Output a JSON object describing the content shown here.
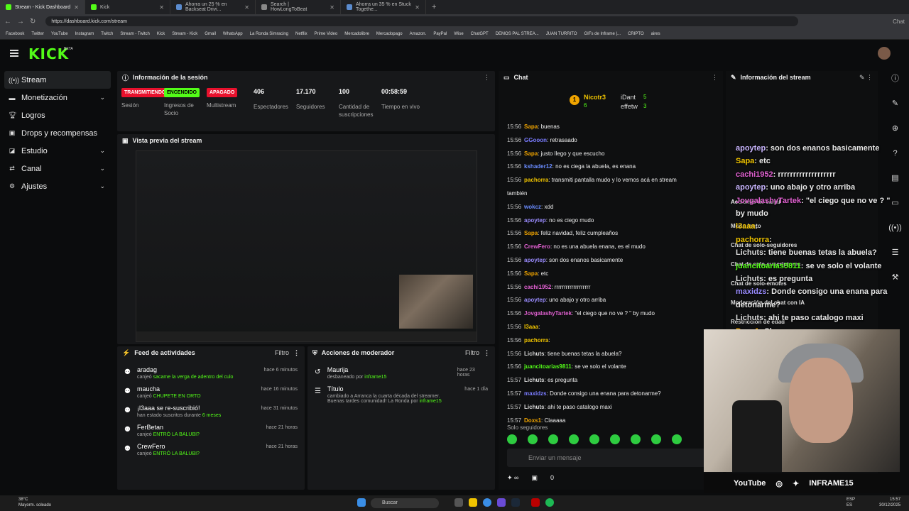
{
  "browser": {
    "tabs": [
      {
        "label": "Stream - Kick Dashboard"
      },
      {
        "label": "Kick"
      },
      {
        "label": "Ahorra un 25 % en Backseat Drivi..."
      },
      {
        "label": "Search | HowLongToBeat"
      },
      {
        "label": "Ahorra un 35 % en Stuck Togethe..."
      }
    ],
    "url": "https://dashboard.kick.com/stream",
    "bookmarks": [
      "Facebook",
      "Twitter",
      "YouTube",
      "Instagram",
      "Twitch",
      "Stream - Twitch",
      "Kick",
      "Stream - Kick",
      "Gmail",
      "WhatsApp",
      "La Ronda Simracing",
      "Netflix",
      "Prime Video",
      "Mercadolibre",
      "Mercadopago",
      "Amazon.",
      "PayPal",
      "Wise",
      "ChatGPT",
      "DEMOS PAL STREA...",
      "JUAN TURRITO",
      "GIFs de Inframe |...",
      "CRIPTO",
      "aires"
    ],
    "chat_btn": "Chat"
  },
  "header": {
    "logo": "KICK",
    "beta": "BETA"
  },
  "sidebar": {
    "items": [
      {
        "label": "Stream"
      },
      {
        "label": "Monetización"
      },
      {
        "label": "Logros"
      },
      {
        "label": "Drops y recompensas"
      },
      {
        "label": "Estudio"
      },
      {
        "label": "Canal"
      },
      {
        "label": "Ajustes"
      }
    ]
  },
  "session": {
    "title": "Información de la sesión",
    "stats": [
      {
        "value": "TRANSMITIENDO",
        "label": "Sesión",
        "kind": "red"
      },
      {
        "value": "ENCENDIDO",
        "label": "Ingresos de Socio",
        "kind": "green"
      },
      {
        "value": "APAGADO",
        "label": "Multistream",
        "kind": "red"
      },
      {
        "value": "406",
        "label": "Espectadores"
      },
      {
        "value": "17.170",
        "label": "Seguidores"
      },
      {
        "value": "100",
        "label": "Cantidad de suscripciones"
      },
      {
        "value": "00:58:59",
        "label": "Tiempo en vivo"
      }
    ]
  },
  "preview": {
    "title": "Vista previa del stream"
  },
  "feed": {
    "title": "Feed de actividades",
    "filter": "Filtro",
    "rows": [
      {
        "name": "aradag",
        "action": "canjeó",
        "detail": "sacame la verga de adentro del culo",
        "time": "hace 6 minutos"
      },
      {
        "name": "maucha",
        "action": "canjeó",
        "detail": "CHUPETE EN ORTO",
        "time": "hace 16 minutos"
      },
      {
        "name": "¡l3aaa se re-suscribió!",
        "action": "han estado suscritos durante",
        "detail": "6 meses",
        "time": "hace 31 minutos"
      },
      {
        "name": "FerBetan",
        "action": "canjeó",
        "detail": "ENTRÓ LA BALUBI?",
        "time": "hace 21 horas"
      },
      {
        "name": "CrewFero",
        "action": "canjeó",
        "detail": "ENTRÓ LA BALUBI?",
        "time": "hace 21 horas"
      }
    ]
  },
  "mod": {
    "title": "Acciones de moderador",
    "filter": "Filtro",
    "rows": [
      {
        "name": "Maurija",
        "detail": "desbaneado por",
        "by": "inframe15",
        "time": "hace 23 horas"
      },
      {
        "name": "Título",
        "detail": "cambiado a Arranca la cuarta década del streamer. Buenas tardes comunidad! La Ronda por",
        "by": "inframe15",
        "time": "hace 1 día"
      }
    ]
  },
  "chat": {
    "title": "Chat",
    "top": [
      {
        "name": "Nicotr3",
        "count": "6"
      },
      {
        "name": "iDant",
        "count": "5"
      },
      {
        "name": "effetw",
        "count": "3"
      }
    ],
    "messages": [
      {
        "time": "15:56",
        "user": "Sapa",
        "color": "#f0a400",
        "text": "buenas"
      },
      {
        "time": "15:56",
        "user": "GGooon",
        "color": "#7a7cff",
        "text": "retrasaado"
      },
      {
        "time": "15:56",
        "user": "Sapa",
        "color": "#f0a400",
        "text": "justo llego y que escucho"
      },
      {
        "time": "15:56",
        "user": "kshader12",
        "color": "#6a8cff",
        "text": "no es ciega la abuela, es enana"
      },
      {
        "time": "15:56",
        "user": "pachorra",
        "color": "#f0c400",
        "text": "transmiti pantalla mudo y lo vemos acá en stream"
      },
      {
        "time": "",
        "user": "",
        "color": "#eee",
        "text": "también"
      },
      {
        "time": "15:56",
        "user": "wokcz",
        "color": "#6a8cff",
        "text": "xdd"
      },
      {
        "time": "15:56",
        "user": "apoytep",
        "color": "#9a8cff",
        "text": "no es ciego mudo"
      },
      {
        "time": "15:56",
        "user": "Sapa",
        "color": "#f0a400",
        "text": "feliz navidad, feliz cumpleaños"
      },
      {
        "time": "15:56",
        "user": "CrewFero",
        "color": "#e060d0",
        "text": "no es una abuela enana, es el mudo"
      },
      {
        "time": "15:56",
        "user": "apoytep",
        "color": "#9a8cff",
        "text": "son dos enanos basicamente"
      },
      {
        "time": "15:56",
        "user": "Sapa",
        "color": "#f0a400",
        "text": "etc"
      },
      {
        "time": "15:56",
        "user": "cachi1952",
        "color": "#e060d0",
        "text": "rrrrrrrrrrrrrrrrrrr"
      },
      {
        "time": "15:56",
        "user": "apoytep",
        "color": "#9a8cff",
        "text": "uno abajo y otro arriba"
      },
      {
        "time": "15:56",
        "user": "JovgalashyTartek",
        "color": "#e060d0",
        "text": "\"el ciego que no ve ? \" by mudo"
      },
      {
        "time": "15:56",
        "user": "l3aaa",
        "color": "#f0c400",
        "text": ""
      },
      {
        "time": "15:56",
        "user": "pachorra",
        "color": "#f0c400",
        "text": ""
      },
      {
        "time": "15:56",
        "user": "Lichuts",
        "color": "#ddd",
        "text": "tiene buenas tetas la abuela?"
      },
      {
        "time": "15:56",
        "user": "juancitoarias9811",
        "color": "#53fc18",
        "text": "se ve solo el volante"
      },
      {
        "time": "15:57",
        "user": "Lichuts",
        "color": "#ddd",
        "text": "es pregunta"
      },
      {
        "time": "15:57",
        "user": "maxidzs",
        "color": "#7a7cff",
        "text": "Donde consigo una enana para detonarme?"
      },
      {
        "time": "15:57",
        "user": "Lichuts",
        "color": "#ddd",
        "text": "ahi te paso catalogo maxi"
      },
      {
        "time": "15:57",
        "user": "Doxs1",
        "color": "#f0a400",
        "text": "Claaaaa"
      }
    ],
    "supporters": "Solo seguidores",
    "placeholder": "Enviar un mensaje",
    "foot_count": "0"
  },
  "info": {
    "title": "Información del stream",
    "mod_title": "Acciones de canal",
    "settings": [
      "Modo lento",
      "Chat de solo-seguidores",
      "Chat de solo-suscriptores",
      "Chat de solo-emotes",
      "Moderación del chat con IA",
      "Restricción de edad"
    ]
  },
  "overlay": [
    {
      "user": "apoytep",
      "text": ": son dos enanos basicamente"
    },
    {
      "user": "Sapa",
      "text": ": etc"
    },
    {
      "user": "cachi1952",
      "text": ": rrrrrrrrrrrrrrrrrrr"
    },
    {
      "user": "apoytep",
      "text": ": uno abajo y otro arriba"
    },
    {
      "user": "JovgalashyTartek",
      "text": ": \"el ciego que no ve ? \" by mudo"
    },
    {
      "user": "l3aaa",
      "text": ":"
    },
    {
      "user": "pachorra",
      "text": ":"
    },
    {
      "user": "Lichuts",
      "text": ": tiene buenas tetas la abuela?"
    },
    {
      "user": "juancitoarias9811",
      "text": ": se ve solo el volante"
    },
    {
      "user": "Lichuts",
      "text": ": es pregunta"
    },
    {
      "user": "maxidzs",
      "text": ": Donde consigo una enana para detonarme?"
    },
    {
      "user": "Lichuts",
      "text": ": ahi te paso catalogo maxi"
    },
    {
      "user": "Doxs1",
      "text": ": Claaaaa"
    }
  ],
  "social": {
    "youtube": "YouTube",
    "handle": "INFRAME15"
  },
  "taskbar": {
    "weather_temp": "38°C",
    "weather_desc": "Mayorm. soleado",
    "search": "Buscar",
    "time": "15:57",
    "date": "30/12/2025",
    "lang": "ESP ES"
  }
}
